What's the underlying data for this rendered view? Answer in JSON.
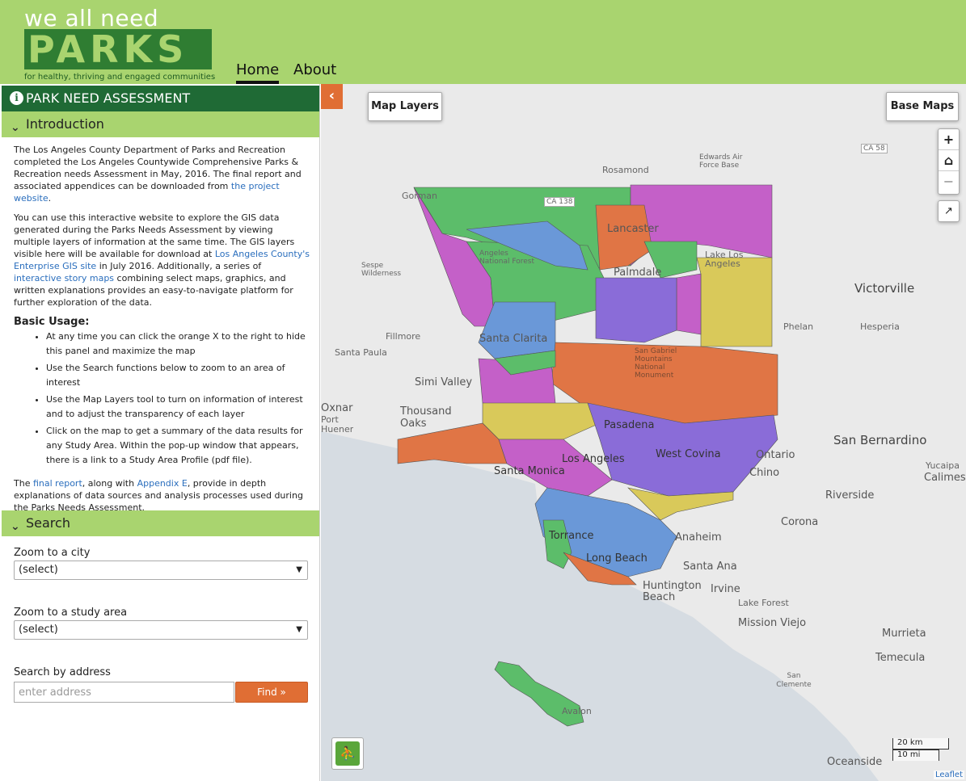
{
  "header": {
    "logo_top": "we all need",
    "logo_word": "PARKS",
    "logo_tagline": "for healthy, thriving and engaged communities",
    "nav": [
      {
        "label": "Home"
      },
      {
        "label": "About"
      }
    ]
  },
  "sidebar": {
    "title": "PARK NEED ASSESSMENT",
    "intro_heading": "Introduction",
    "intro_p1_a": "The Los Angeles County Department of Parks and Recreation completed the Los Angeles Countywide Comprehensive Parks & Recreation needs Assessment in May, 2016. The final report and associated appendices can be downloaded from ",
    "intro_p1_link": "the project website",
    "intro_p1_b": ".",
    "intro_p2_a": "You can use this interactive website to explore the GIS data generated during the Parks Needs Assessment by viewing multiple layers of information at the same time. The GIS layers visible here will be available for download at ",
    "intro_p2_link1": "Los Angeles County's Enterprise GIS site",
    "intro_p2_b": " in July 2016. Additionally, a series of ",
    "intro_p2_link2": "interactive story maps",
    "intro_p2_c": " combining select maps, graphics, and written explanations provides an easy-to-navigate platform for further exploration of the data.",
    "usage_title": "Basic Usage:",
    "usage_items": [
      "At any time you can click the orange X to the right to hide this panel and maximize the map",
      "Use the Search functions below to zoom to an area of interest",
      "Use the Map Layers tool to turn on information of interest and to adjust the transparency of each layer",
      "Click on the map to get a summary of the data results for any Study Area. Within the pop-up window that appears, there is a link to a Study Area Profile (pdf file)."
    ],
    "intro_p3_a": "The ",
    "intro_p3_link1": "final report",
    "intro_p3_b": ", along with ",
    "intro_p3_link2": "Appendix E",
    "intro_p3_c": ", provide in depth explanations of data sources and analysis processes used during the Parks Needs Assessment.",
    "search_heading": "Search",
    "city_label": "Zoom to a city",
    "city_value": "(select)",
    "study_label": "Zoom to a study area",
    "study_value": "(select)",
    "address_label": "Search by address",
    "address_placeholder": "enter address",
    "find_label": "Find »"
  },
  "map": {
    "layers_btn": "Map Layers",
    "basemaps_btn": "Base Maps",
    "zoom_in": "+",
    "home": "⌂",
    "zoom_out": "−",
    "share": "↗",
    "places": [
      {
        "label": "Victorville"
      },
      {
        "label": "Hesperia"
      },
      {
        "label": "Phelan"
      },
      {
        "label": "Rosamond"
      },
      {
        "label": "Edwards Air Force Base"
      },
      {
        "label": "Lancaster"
      },
      {
        "label": "Palmdale"
      },
      {
        "label": "Lake Los Angeles"
      },
      {
        "label": "Gorman"
      },
      {
        "label": "Angeles National Forest"
      },
      {
        "label": "Sespe Wilderness"
      },
      {
        "label": "Fillmore"
      },
      {
        "label": "Santa Paula"
      },
      {
        "label": "Santa Clarita"
      },
      {
        "label": "Simi Valley"
      },
      {
        "label": "Thousand Oaks"
      },
      {
        "label": "Oxnard"
      },
      {
        "label": "Port Hueneme"
      },
      {
        "label": "San Bernardino"
      },
      {
        "label": "Ontario"
      },
      {
        "label": "Chino"
      },
      {
        "label": "Riverside"
      },
      {
        "label": "Corona"
      },
      {
        "label": "Yucaipa"
      },
      {
        "label": "Calimesa"
      },
      {
        "label": "Anaheim"
      },
      {
        "label": "Santa Ana"
      },
      {
        "label": "Irvine"
      },
      {
        "label": "Huntington Beach"
      },
      {
        "label": "Lake Forest"
      },
      {
        "label": "Mission Viejo"
      },
      {
        "label": "Murrieta"
      },
      {
        "label": "Temecula"
      },
      {
        "label": "San Clemente"
      },
      {
        "label": "Oceanside"
      },
      {
        "label": "Los Angeles"
      },
      {
        "label": "Torrance"
      },
      {
        "label": "Long Beach"
      },
      {
        "label": "Santa Monica"
      },
      {
        "label": "Avalon"
      },
      {
        "label": "West Covina"
      },
      {
        "label": "Pasadena"
      },
      {
        "label": "CA 138"
      },
      {
        "label": "CA 58"
      },
      {
        "label": "San Gabriel Mountains National Monument"
      }
    ],
    "scale_km": "20 km",
    "scale_mi": "10 mi",
    "attribution": "Leaflet",
    "colors": {
      "green": "#5cbd6a",
      "purple": "#c460c8",
      "blue": "#6a98d8",
      "orange": "#e07545",
      "yellow": "#d9c95a",
      "violet": "#8a6cd8",
      "ocean": "#d6dce2",
      "land": "#ececec"
    }
  }
}
